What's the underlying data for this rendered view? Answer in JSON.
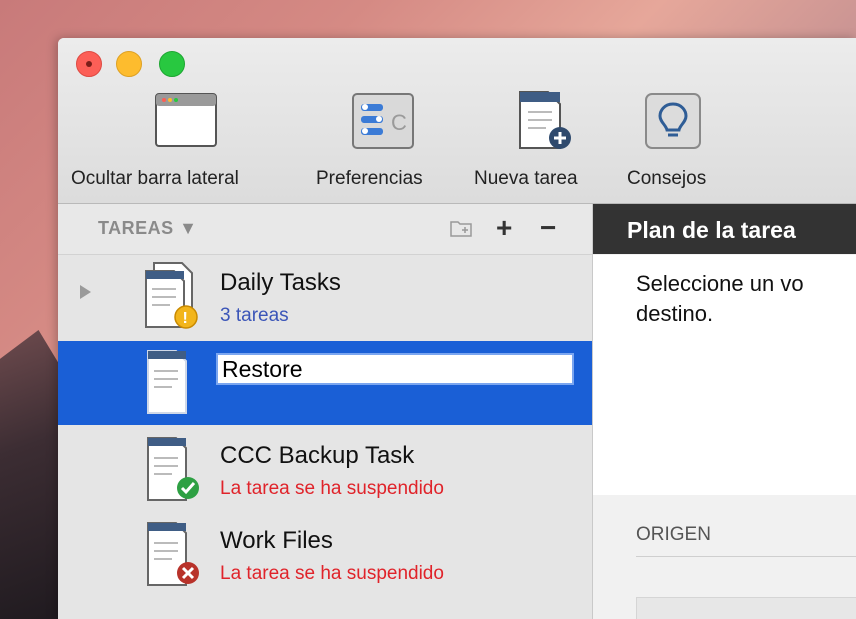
{
  "toolbar": {
    "hide_sidebar": "Ocultar barra lateral",
    "preferences": "Preferencias",
    "new_task": "Nueva tarea",
    "tips": "Consejos"
  },
  "sidebar": {
    "header": "TAREAS",
    "tasks": [
      {
        "name": "Daily Tasks",
        "status": "3 tareas",
        "badge": "warning-icon"
      },
      {
        "name": "",
        "edit_value": "Restore",
        "selected": true
      },
      {
        "name": "CCC Backup Task",
        "status": "La tarea se ha suspendido",
        "badge": "checkmark-icon"
      },
      {
        "name": "Work Files",
        "status": "La tarea se ha suspendido",
        "badge": "error-x-icon"
      }
    ]
  },
  "main": {
    "header": "Plan de la tarea",
    "message": "Seleccione un vo destino.",
    "origin_label": "ORIGEN"
  },
  "colors": {
    "selection": "#1a5fd6",
    "error_text": "#e0232a",
    "ok_text": "#3b55b8"
  }
}
